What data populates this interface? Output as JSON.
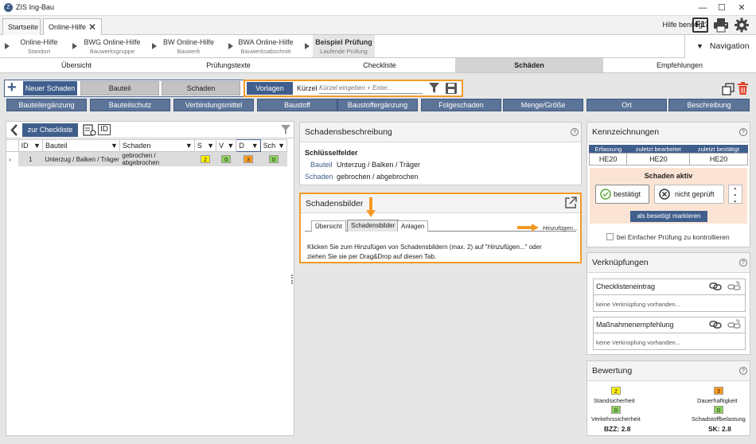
{
  "window": {
    "title": "ZIS Ing-Bau",
    "logo_letter": "Z",
    "min": "—",
    "max": "☐",
    "close": "✕"
  },
  "tabs": [
    {
      "label": "Startseite"
    },
    {
      "label": "Online-Hilfe",
      "close": "✕"
    }
  ],
  "topbar": {
    "help_label": "Hilfe benötigt?",
    "f1": "F1"
  },
  "breadcrumb": [
    {
      "title": "Online-Hilfe",
      "sub": "Standort"
    },
    {
      "title": "BWG Online-Hilfe",
      "sub": "Bauwerksgruppe"
    },
    {
      "title": "BW Online-Hilfe",
      "sub": "Bauwerk"
    },
    {
      "title": "BWA Online-Hilfe",
      "sub": "Bauwerksabschnitt"
    },
    {
      "title": "Beispiel Prüfung",
      "sub": "Laufende Prüfung"
    }
  ],
  "navigation": {
    "label": "Navigation",
    "arrow": "▼"
  },
  "main_tabs": [
    "Übersicht",
    "Prüfungstexte",
    "Checkliste",
    "Schäden",
    "Empfehlungen"
  ],
  "toolbar": {
    "plus": "+",
    "new_damage": "Neuer Schaden",
    "bauteil": "Bauteil",
    "schaden": "Schaden",
    "vorlagen": "Vorlagen",
    "kuerzel_label": "Kürzel",
    "kuerzel_placeholder": "Kürzel eingeben + Enter..."
  },
  "categories": [
    "Bauteilergänzung",
    "Bauteilschutz",
    "Verbindungsmittel",
    "Baustoff",
    "Baustoffergänzung",
    "Folgeschaden",
    "Menge/Größe",
    "Ort",
    "Beschreibung"
  ],
  "left": {
    "back": "zur Checkliste",
    "id_label": "ID",
    "columns": [
      "ID",
      "Bauteil",
      "Schaden",
      "S",
      "V",
      "D",
      "Sch"
    ],
    "rows": [
      {
        "expand": "›",
        "id": "1",
        "bauteil": "Unterzug / Balken / Träger",
        "schaden": "gebrochen / abgebrochen",
        "s": "2",
        "v": "0",
        "d": "3",
        "sch": "0"
      }
    ]
  },
  "description": {
    "title": "Schadensbeschreibung",
    "help": "?",
    "key_fields": "Schlüsselfelder",
    "fields": [
      {
        "label": "Bauteil",
        "value": "Unterzug / Balken / Träger"
      },
      {
        "label": "Schaden",
        "value": "gebrochen / abgebrochen"
      }
    ]
  },
  "images": {
    "title": "Schadensbilder",
    "tabs": [
      "Übersicht",
      "Schadensbilder",
      "Anlagen"
    ],
    "add": "Hinzufügen...",
    "hint_prefix": "Klicken Sie zum Hinzufügen von Schadensbildern (max. 2) auf \"",
    "hint_em": "Hinzufügen...",
    "hint_suffix": "\" oder",
    "hint_line2": "ziehen Sie sie per Drag&Drop auf diesen Tab."
  },
  "marks": {
    "title": "Kennzeichnungen",
    "help": "?",
    "cols": [
      "Erfassung",
      "zuletzt bearbeitet",
      "zuletzt bestätigt"
    ],
    "vals": [
      "HE20",
      "HE20",
      "HE20"
    ],
    "status_title": "Schaden aktiv",
    "confirmed": "bestätigt",
    "not_checked": "nicht geprüft",
    "mark_removed": "als beseitigt markieren",
    "simple_check": "bei Einfacher Prüfung zu kontrollieren"
  },
  "links": {
    "title": "Verknüpfungen",
    "help": "?",
    "items": [
      {
        "label": "Checklisteneintrag",
        "empty": "keine Verknüpfung vorhanden..."
      },
      {
        "label": "Maßnahmenempfehlung",
        "empty": "keine Verknüpfung vorhanden..."
      }
    ]
  },
  "rating": {
    "title": "Bewertung",
    "help": "?",
    "s_val": "2",
    "s_label": "Standsicherheit",
    "d_val": "3",
    "d_label": "Dauerhaftigkeit",
    "v_val": "0",
    "v_label": "Verkehrssicherheit",
    "sch_val": "0",
    "sch_label": "Schadstoffbelastung",
    "bzz": "BZZ: 2.8",
    "sk": "SK: 2.8"
  },
  "colors": {
    "accent": "#3f5e8c",
    "orange": "#f39a26",
    "yellow": "#fff000",
    "green": "#8bd15a",
    "badge_orange": "#ff9d1e",
    "red": "#e0402a"
  }
}
